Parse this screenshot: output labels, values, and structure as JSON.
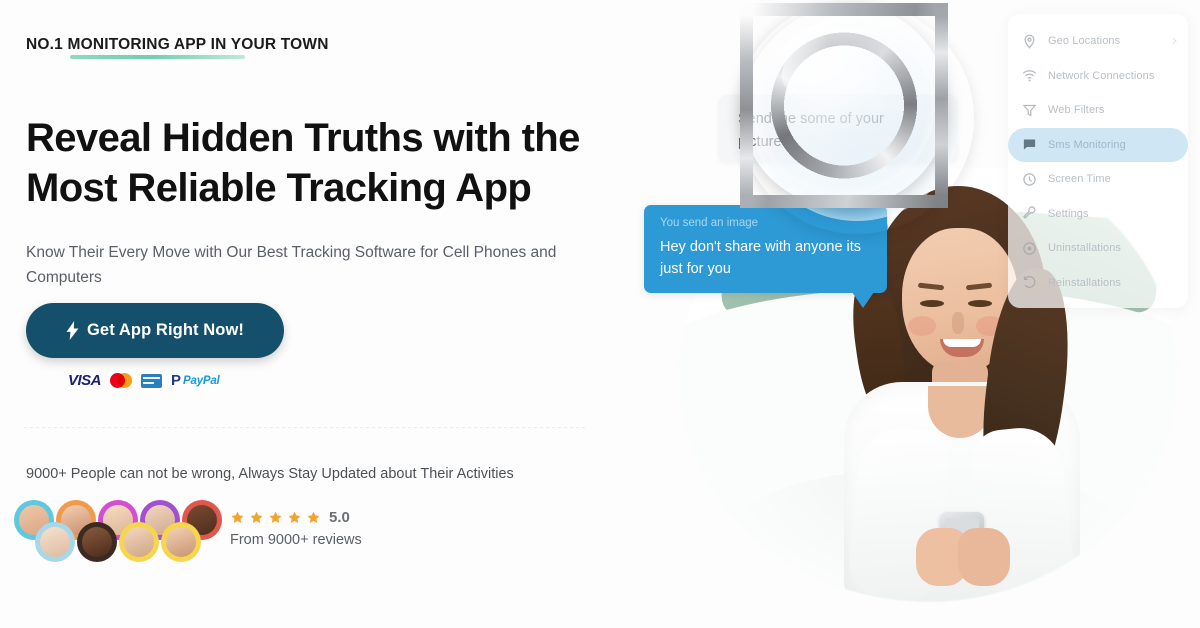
{
  "hero": {
    "eyebrow": "NO.1 MONITORING APP IN YOUR TOWN",
    "headline_line1": "Reveal Hidden Truths with the",
    "headline_line2": "Most Reliable Tracking App",
    "subhead": "Know Their Every Move with Our Best Tracking Software for Cell Phones and Computers",
    "cta_label": "Get App Right Now!",
    "accent_underline_color": "#7fd4bb",
    "cta_bg_color": "#14506b"
  },
  "payments": {
    "visa": "VISA",
    "paypal_word": "PayPal",
    "paypal_mark": "P",
    "items": [
      "visa-logo",
      "mastercard-logo",
      "card-logo",
      "paypal-logo"
    ]
  },
  "social_proof": {
    "headline": "9000+ People can not be wrong, Always Stay Updated about Their Activities",
    "rating_value": "5.0",
    "reviews_text": "From 9000+ reviews",
    "star_count": 5,
    "star_color": "#f0a431",
    "avatar_count": 9,
    "avatar_rings": [
      "#5ec8e0",
      "#f09a4a",
      "#d44fd0",
      "#a24fd0",
      "#e2574c",
      "#a8d7ea",
      "#3b2a22",
      "#f5d64e",
      "#f5d64e"
    ]
  },
  "phone_preview": {
    "received_message": "Send me some of your pictures",
    "sent_meta": "You send an image",
    "sent_message": "Hey don't share with anyone its just for you",
    "sent_bubble_color": "#2d9ad6",
    "magnifier": "magnifier-lens"
  },
  "app_menu": {
    "highlight_color": "#cfe6f5",
    "items": [
      {
        "label": "Geo Locations",
        "icon": "location-pin-icon",
        "has_chevron": true,
        "active": false
      },
      {
        "label": "Network Connections",
        "icon": "wifi-icon",
        "has_chevron": false,
        "active": false
      },
      {
        "label": "Web Filters",
        "icon": "filter-funnel-icon",
        "has_chevron": false,
        "active": false
      },
      {
        "label": "Sms Monitoring",
        "icon": "chat-bubble-icon",
        "has_chevron": false,
        "active": true
      },
      {
        "label": "Screen Time",
        "icon": "clock-icon",
        "has_chevron": false,
        "active": false
      },
      {
        "label": "Settings",
        "icon": "wrench-icon",
        "has_chevron": false,
        "active": false
      },
      {
        "label": "Uninstallations",
        "icon": "target-circle-icon",
        "has_chevron": false,
        "active": false
      },
      {
        "label": "Reinstallations",
        "icon": "undo-arrow-icon",
        "has_chevron": false,
        "active": false
      }
    ]
  }
}
